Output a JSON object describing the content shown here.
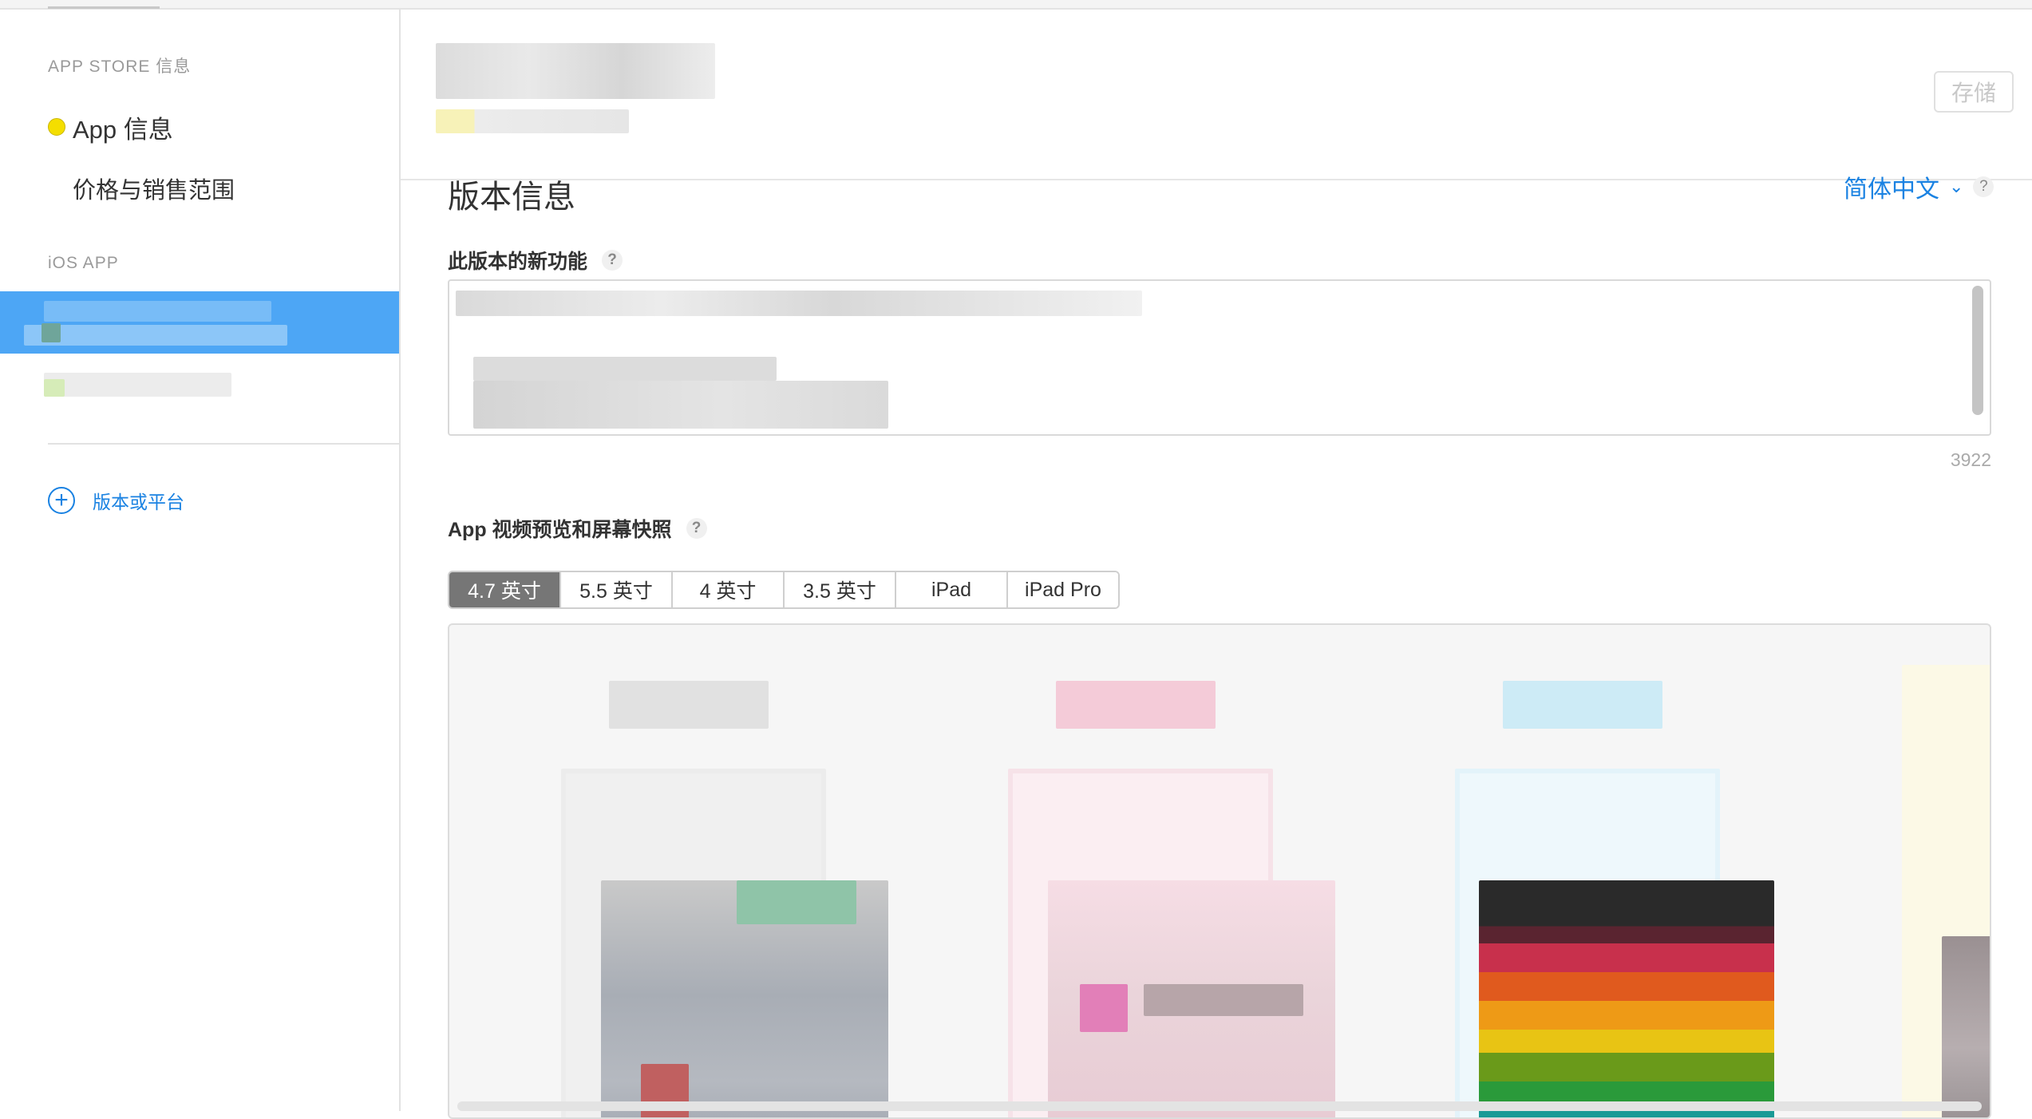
{
  "sidebar": {
    "appstore_heading": "APP STORE 信息",
    "items": [
      {
        "label": "App 信息",
        "status_color": "#f4de00"
      },
      {
        "label": "价格与销售范围"
      }
    ],
    "ios_heading": "iOS APP",
    "add_label": "版本或平台"
  },
  "header": {
    "save_label": "存储"
  },
  "version_section": {
    "title": "版本信息",
    "language": "简体中文",
    "whats_new_label": "此版本的新功能",
    "char_count": "3922"
  },
  "media_section": {
    "label": "App 视频预览和屏幕快照",
    "size_tabs": [
      "4.7 英寸",
      "5.5 英寸",
      "4 英寸",
      "3.5 英寸",
      "iPad",
      "iPad Pro"
    ],
    "active_tab": "4.7 英寸"
  },
  "help_glyph": "?",
  "colors": {
    "accent": "#1a82e2",
    "selected_bg": "#4da6f5",
    "status_dot": "#f4de00"
  }
}
